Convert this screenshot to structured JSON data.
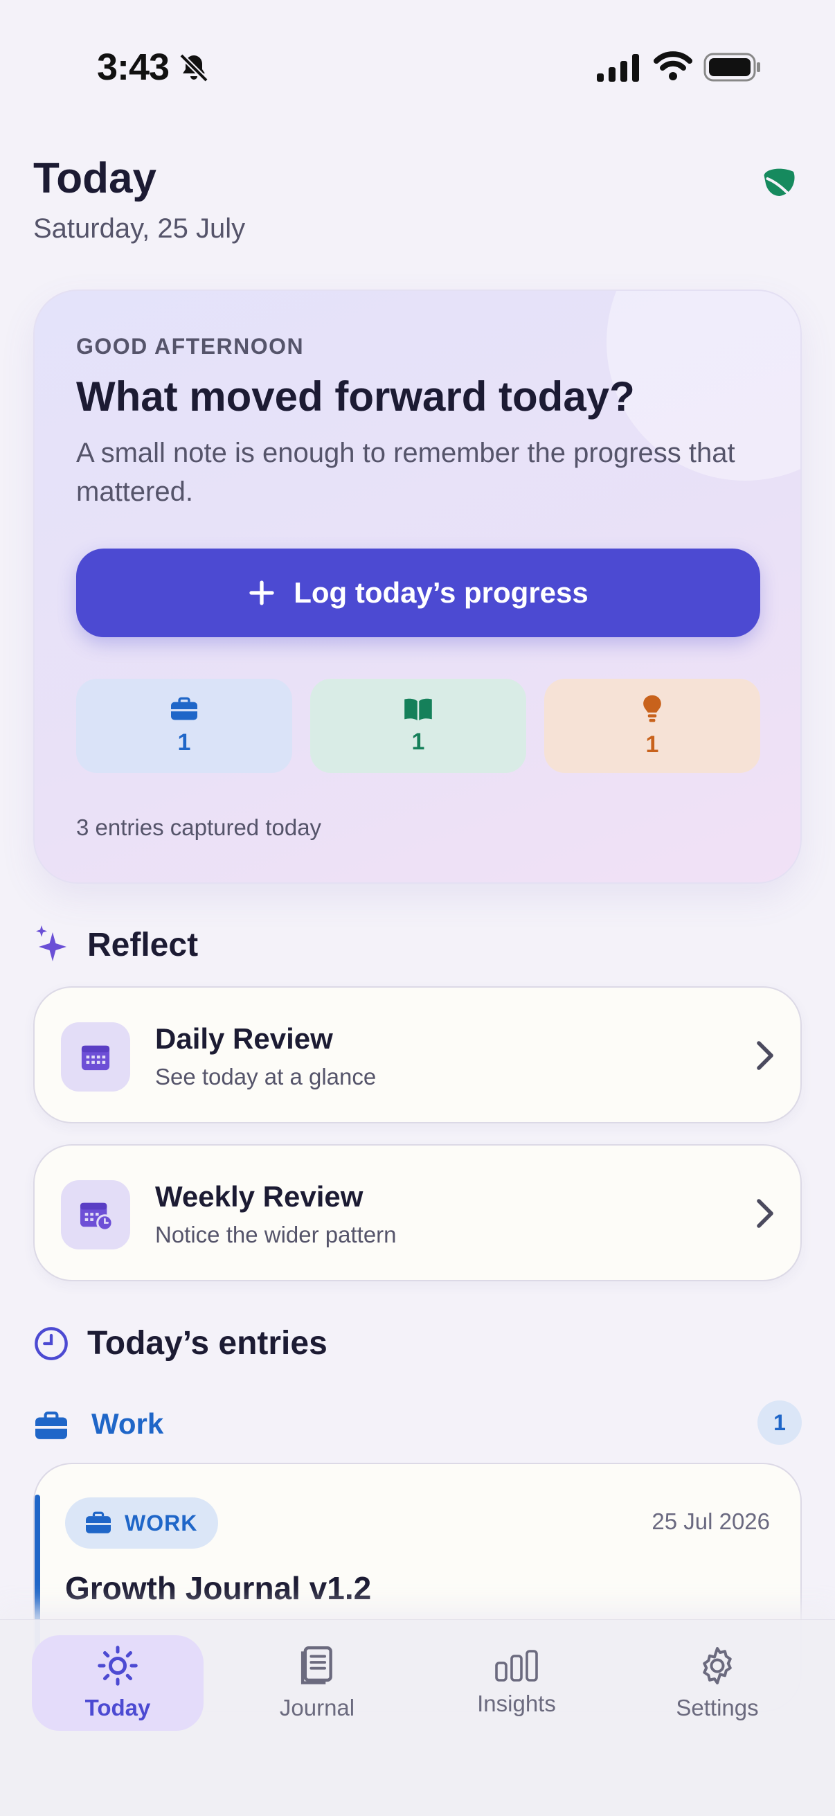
{
  "status_bar": {
    "time": "3:43"
  },
  "header": {
    "title": "Today",
    "date": "Saturday, 25 July"
  },
  "hero": {
    "eyebrow": "GOOD AFTERNOON",
    "heading": "What moved forward today?",
    "subtitle": "A small note is enough to remember the progress that mattered.",
    "cta_label": "Log today’s progress",
    "stats": [
      {
        "icon": "briefcase-icon",
        "count": "1",
        "color": "#1f66c8"
      },
      {
        "icon": "book-icon",
        "count": "1",
        "color": "#15805a"
      },
      {
        "icon": "lightbulb-icon",
        "count": "1",
        "color": "#c8621c"
      }
    ],
    "footer": "3 entries captured today"
  },
  "reflect": {
    "title": "Reflect",
    "cards": [
      {
        "title": "Daily Review",
        "subtitle": "See today at a glance"
      },
      {
        "title": "Weekly Review",
        "subtitle": "Notice the wider pattern"
      }
    ]
  },
  "entries": {
    "title": "Today’s entries",
    "groups": [
      {
        "label": "Work",
        "count": "1",
        "items": [
          {
            "category": "WORK",
            "date": "25 Jul 2026",
            "title": "Growth Journal v1.2"
          }
        ]
      }
    ]
  },
  "tabs": [
    {
      "label": "Today",
      "active": true
    },
    {
      "label": "Journal"
    },
    {
      "label": "Insights"
    },
    {
      "label": "Settings"
    }
  ],
  "colors": {
    "primary": "#4c4ad2",
    "work": "#1f66c8",
    "learning": "#15805a",
    "idea": "#c8621c",
    "leaf": "#168a5e"
  }
}
